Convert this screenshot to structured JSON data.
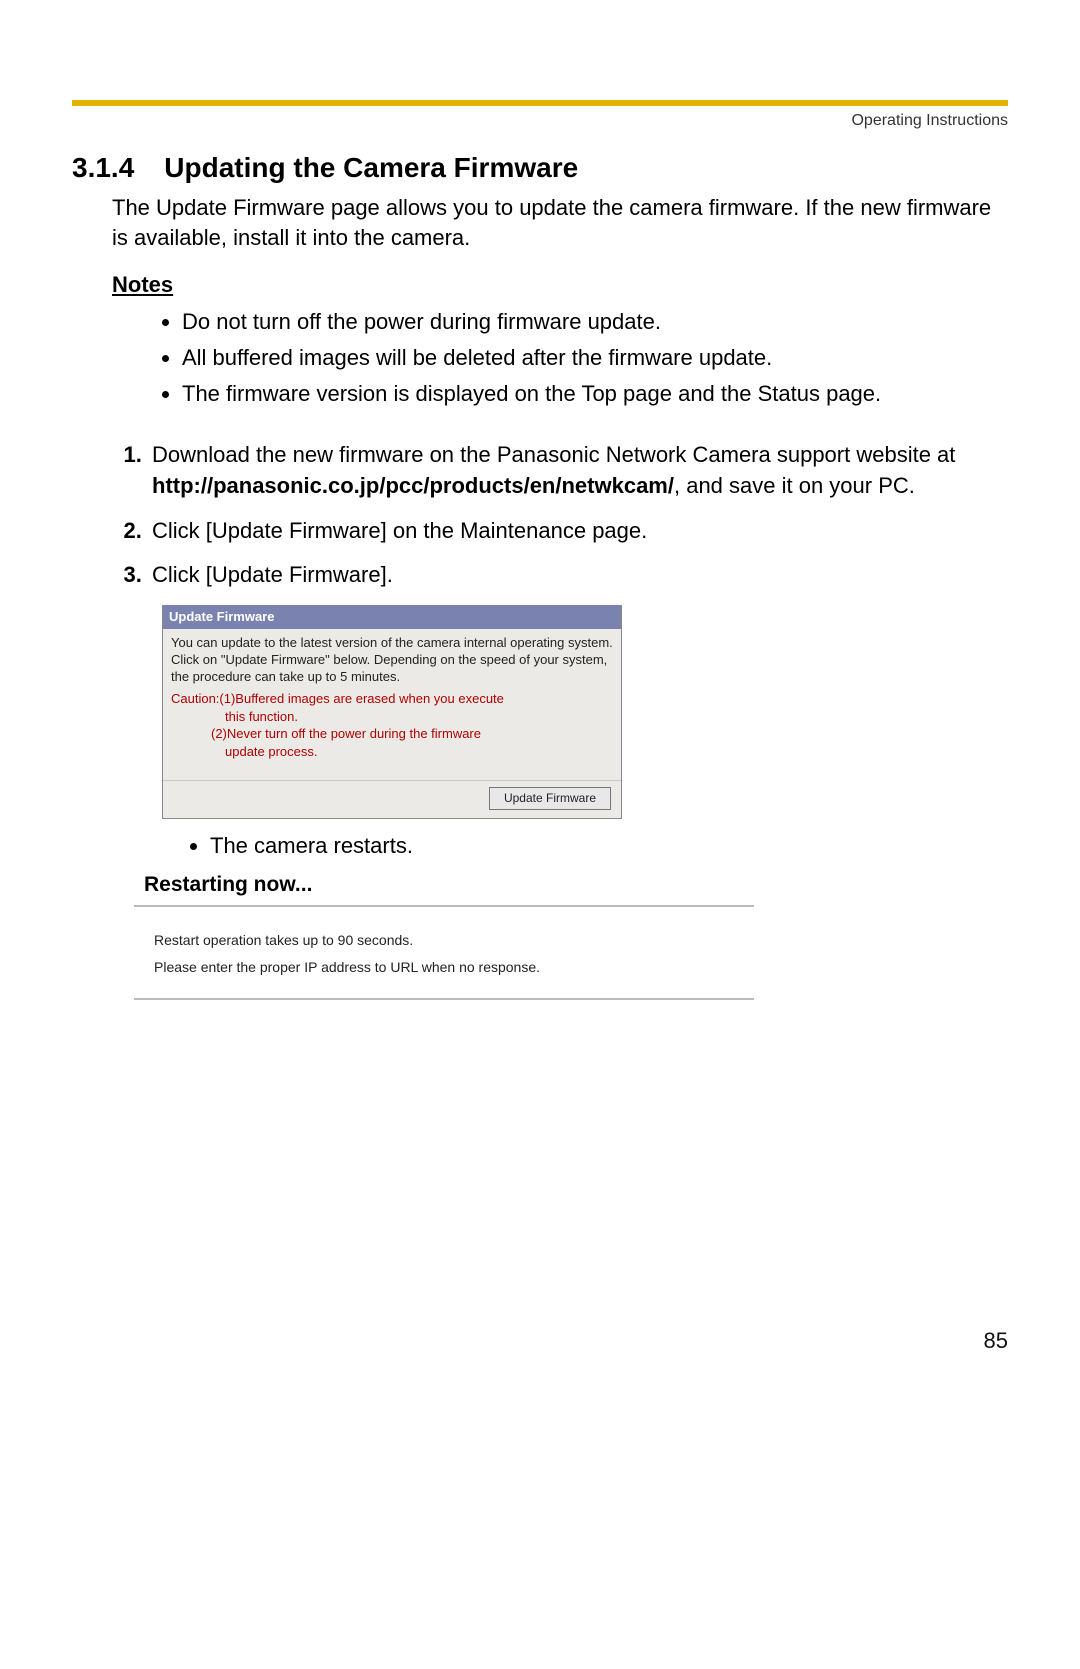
{
  "header": {
    "right_label": "Operating Instructions"
  },
  "section": {
    "number": "3.1.4",
    "title": "Updating the Camera Firmware"
  },
  "intro": "The Update Firmware page allows you to update the camera firmware. If the new firmware is available, install it into the camera.",
  "notes_heading": "Notes",
  "notes": [
    "Do not turn off the power during firmware update.",
    "All buffered images will be deleted after the firmware update.",
    "The firmware version is displayed on the Top page and the Status page."
  ],
  "steps": {
    "s1_pre": "Download the new firmware on the Panasonic Network Camera support website at ",
    "s1_url": "http://panasonic.co.jp/pcc/products/en/netwkcam/",
    "s1_post": ", and save it on your PC.",
    "s2": "Click [Update Firmware] on the Maintenance page.",
    "s3": "Click [Update Firmware]."
  },
  "dialog": {
    "title": "Update Firmware",
    "body": "You can update to the latest version of the camera internal operating system.\nClick on \"Update Firmware\" below. Depending on the speed of your system, the procedure can take up to 5 minutes.",
    "caution_l1": "Caution:(1)Buffered images are erased when you execute",
    "caution_l1b": "this function.",
    "caution_l2": "(2)Never turn off the power during the firmware",
    "caution_l2b": "update process.",
    "button": "Update Firmware"
  },
  "substep_text": "The camera restarts.",
  "restart": {
    "heading": "Restarting now...",
    "line1": "Restart operation takes up to 90 seconds.",
    "line2": "Please enter the proper IP address to URL when no response."
  },
  "page_number": "85"
}
